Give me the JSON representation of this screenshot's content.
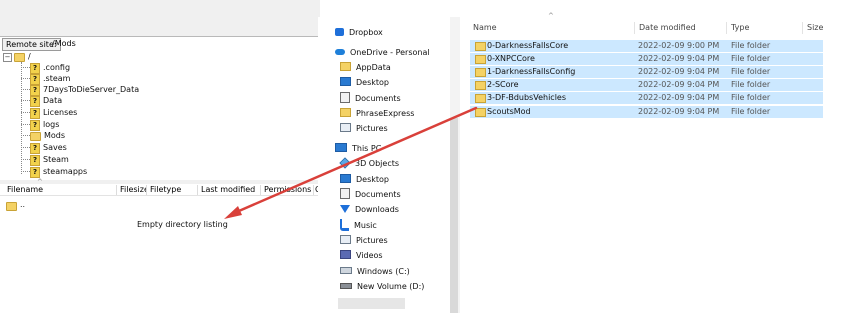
{
  "filezilla": {
    "remote_site_label": "Remote site:",
    "remote_site_path": "/Mods",
    "tree": {
      "root": "/",
      "expander": "−",
      "children": [
        ".config",
        ".steam",
        "7DaysToDieServer_Data",
        "Data",
        "Licenses",
        "logs",
        "Mods",
        "Saves",
        "Steam",
        "steamapps"
      ],
      "unknown_glyph": "?"
    },
    "columns": [
      "Filename",
      "Filesize",
      "Filetype",
      "Last modified",
      "Permissions",
      "O"
    ],
    "updir": "..",
    "empty_message": "Empty directory listing"
  },
  "explorer": {
    "nav": [
      {
        "label": "Dropbox",
        "icon": "dropbox-icon"
      },
      {
        "label": "OneDrive - Personal",
        "icon": "onedrive-icon"
      },
      {
        "label": "AppData",
        "icon": "folder-icon"
      },
      {
        "label": "Desktop",
        "icon": "desktop-icon"
      },
      {
        "label": "Documents",
        "icon": "documents-icon"
      },
      {
        "label": "PhraseExpress",
        "icon": "folder-icon"
      },
      {
        "label": "Pictures",
        "icon": "pictures-icon"
      },
      {
        "label": "This PC",
        "icon": "computer-icon"
      },
      {
        "label": "3D Objects",
        "icon": "objects-3d-icon"
      },
      {
        "label": "Desktop",
        "icon": "desktop-icon"
      },
      {
        "label": "Documents",
        "icon": "documents-icon"
      },
      {
        "label": "Downloads",
        "icon": "downloads-icon"
      },
      {
        "label": "Music",
        "icon": "music-icon"
      },
      {
        "label": "Pictures",
        "icon": "pictures-icon"
      },
      {
        "label": "Videos",
        "icon": "videos-icon"
      },
      {
        "label": "Windows (C:)",
        "icon": "drive-icon"
      },
      {
        "label": "New Volume (D:)",
        "icon": "drive-icon"
      }
    ],
    "columns": [
      "Name",
      "Date modified",
      "Type",
      "Size"
    ],
    "files": [
      {
        "name": "0-DarknessFallsCore",
        "date": "2022-02-09 9:00 PM",
        "type": "File folder"
      },
      {
        "name": "0-XNPCCore",
        "date": "2022-02-09 9:04 PM",
        "type": "File folder"
      },
      {
        "name": "1-DarknessFallsConfig",
        "date": "2022-02-09 9:04 PM",
        "type": "File folder"
      },
      {
        "name": "2-SCore",
        "date": "2022-02-09 9:04 PM",
        "type": "File folder"
      },
      {
        "name": "3-DF-BdubsVehicles",
        "date": "2022-02-09 9:04 PM",
        "type": "File folder"
      },
      {
        "name": "ScoutsMod",
        "date": "2022-02-09 9:04 PM",
        "type": "File folder"
      }
    ],
    "selection_color": "#cce8ff"
  },
  "annotation": {
    "arrow_color": "#d9403a"
  }
}
